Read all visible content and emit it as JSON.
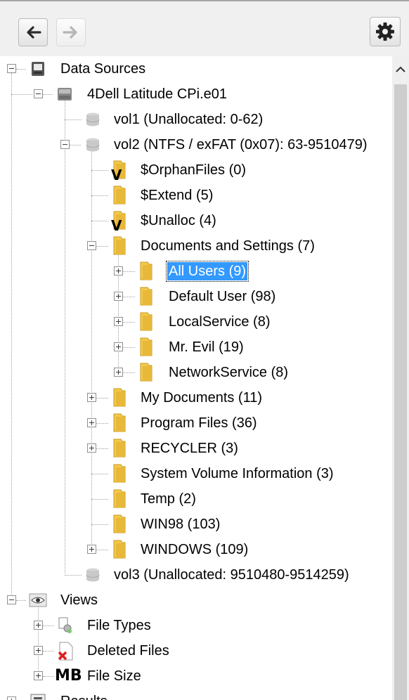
{
  "toolbar": {
    "back_icon": "arrow-left-icon",
    "forward_icon": "arrow-right-icon",
    "settings_icon": "gear-icon"
  },
  "tree": {
    "data_sources": "Data Sources",
    "image": "4Dell Latitude CPi.e01",
    "vol1": "vol1 (Unallocated: 0-62)",
    "vol2": "vol2 (NTFS / exFAT (0x07): 63-9510479)",
    "orphan": "$OrphanFiles (0)",
    "extend": "$Extend (5)",
    "unalloc": "$Unalloc (4)",
    "docs": "Documents and Settings (7)",
    "all_users": "All Users (9)",
    "default_user": "Default User (98)",
    "local_service": "LocalService (8)",
    "mr_evil": "Mr. Evil (19)",
    "network_service": "NetworkService (8)",
    "my_documents": "My Documents (11)",
    "program_files": "Program Files (36)",
    "recycler": "RECYCLER (3)",
    "svi": "System Volume Information (3)",
    "temp": "Temp (2)",
    "win98": "WIN98 (103)",
    "windows": "WINDOWS (109)",
    "vol3": "vol3 (Unallocated: 9510480-9514259)",
    "views": "Views",
    "file_types": "File Types",
    "deleted_files": "Deleted Files",
    "mb_icon_text": "MB",
    "file_size": "File Size",
    "results": "Results",
    "virtual_mark": "V"
  }
}
